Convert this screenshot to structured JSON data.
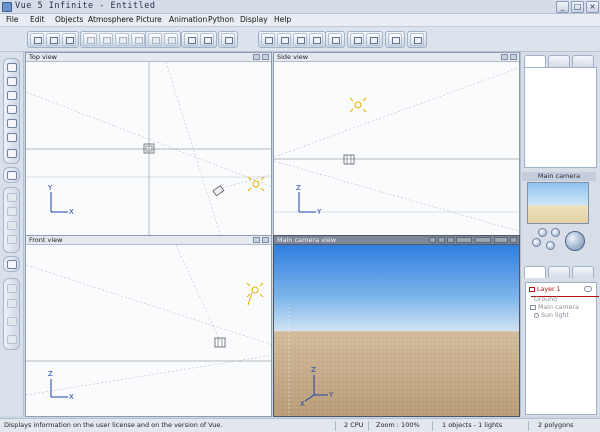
{
  "window": {
    "title": "Vue 5 Infinite - Entitled",
    "controls": [
      "_",
      "□",
      "×"
    ]
  },
  "menu": [
    "File",
    "Edit",
    "Objects",
    "Atmosphere",
    "Picture",
    "Animation",
    "Python",
    "Display",
    "Help"
  ],
  "viewports": {
    "top": {
      "label": "Top view",
      "axes": [
        "Y",
        "X"
      ]
    },
    "side": {
      "label": "Side view",
      "axes": [
        "Z",
        "Y"
      ]
    },
    "front": {
      "label": "Front view",
      "axes": [
        "Z",
        "X"
      ]
    },
    "camera": {
      "label": "Main camera view",
      "axes": [
        "Z",
        "Y",
        "X"
      ]
    }
  },
  "right_panel": {
    "camera_title": "Main camera",
    "layers": [
      {
        "name": "Layer 1",
        "active": true
      },
      {
        "name": "Ground",
        "active": false
      },
      {
        "name": "Main camera",
        "active": false
      },
      {
        "name": "Sun light",
        "active": false
      }
    ]
  },
  "status": {
    "message": "Displays information on the user license and on the version of Vue.",
    "cpu": "2 CPU",
    "zoom": "Zoom : 100%",
    "objects": "1 objects - 1 lights",
    "polygons": "2 polygons"
  },
  "colors": {
    "sky_top": "#2f7fe0",
    "sky_bottom": "#cfe3f3",
    "ground": "#c9b08f",
    "sun": "#e8b400",
    "axis": "#1d3fa8",
    "active_layer": "#b01515"
  }
}
